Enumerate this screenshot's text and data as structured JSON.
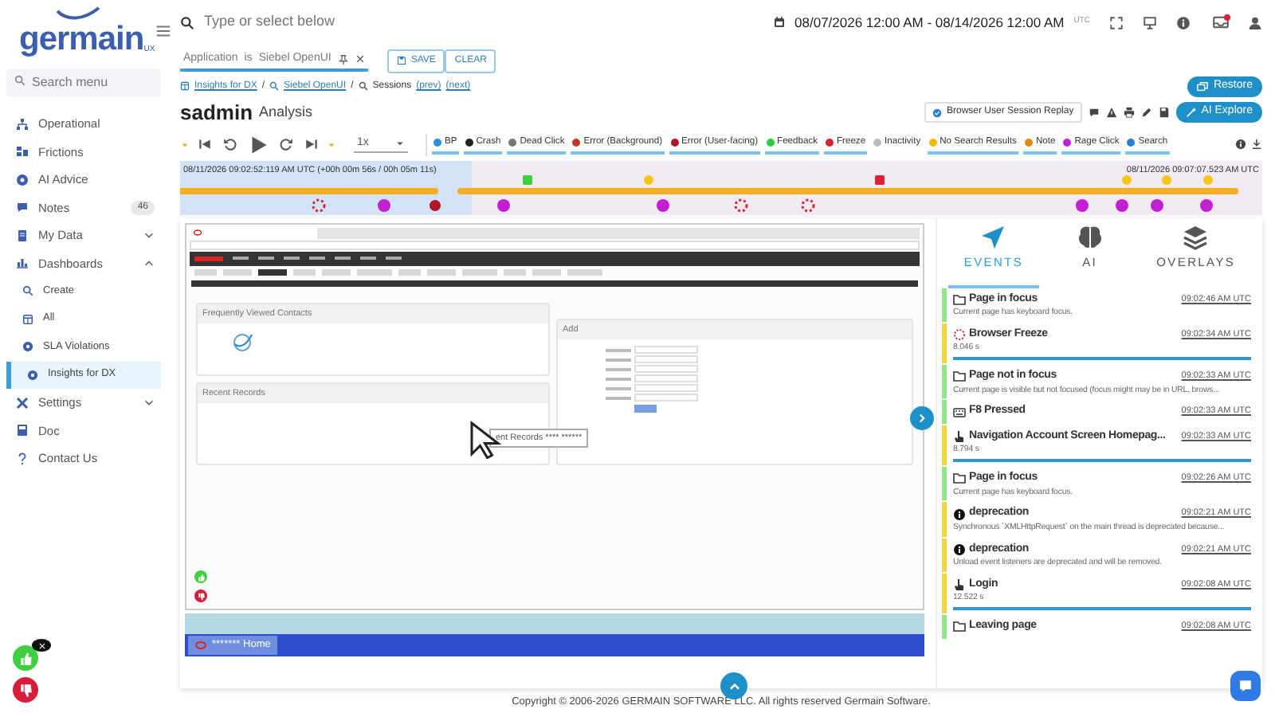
{
  "logo": {
    "name": "germain",
    "tag": "UX"
  },
  "sidebar": {
    "search": {
      "placeholder": "Search menu"
    },
    "items": [
      {
        "label": "Operational",
        "selected": false
      },
      {
        "label": "Frictions",
        "selected": false
      },
      {
        "label": "AI Advice",
        "selected": false
      },
      {
        "label": "Notes",
        "badge": "46",
        "selected": false
      },
      {
        "label": "My Data",
        "expanded": false,
        "selected": false
      },
      {
        "label": "Dashboards",
        "expanded": true,
        "selected": false,
        "children": [
          {
            "label": "Create",
            "selected": false
          },
          {
            "label": "All",
            "selected": false
          },
          {
            "label": "SLA Violations",
            "selected": false
          },
          {
            "label": "Insights for DX",
            "selected": true
          }
        ]
      },
      {
        "label": "Settings",
        "expanded": false,
        "selected": false
      },
      {
        "label": "Doc",
        "selected": false
      },
      {
        "label": "Contact Us",
        "selected": false
      }
    ]
  },
  "topbar": {
    "search": {
      "placeholder": "Type or select below"
    },
    "date_range": "08/07/2026 12:00 AM - 08/14/2026 12:00 AM",
    "timezone": "UTC",
    "notifications_unread": true
  },
  "filter": {
    "field": "Application",
    "operator": "is",
    "value": "Siebel OpenUI",
    "buttons": [
      "SAVE",
      "CLEAR"
    ]
  },
  "breadcrumb": [
    "Insights for DX",
    "Siebel OpenUI",
    "Sessions"
  ],
  "breadcrumb_separator": "/",
  "pager": [
    "(prev)",
    "(next)"
  ],
  "restore_button": "Restore",
  "title": "sadmin",
  "subtitle": "Analysis",
  "replay_label": "Browser User Session Replay",
  "ai_button": "AI Explore",
  "player": {
    "speed": "1x",
    "filters": [
      {
        "label": "BP",
        "color": "#2a8fd6",
        "selected": true
      },
      {
        "label": "Crash",
        "color": "#222222",
        "selected": true
      },
      {
        "label": "Dead Click",
        "color": "#777777",
        "selected": true
      },
      {
        "label": "Error (Background)",
        "color": "#c0392b",
        "selected": true
      },
      {
        "label": "Error (User-facing)",
        "color": "#b0182a",
        "selected": true
      },
      {
        "label": "Feedback",
        "color": "#2ecc40",
        "selected": true
      },
      {
        "label": "Freeze",
        "color": "#d9232d",
        "selected": true
      },
      {
        "label": "Inactivity",
        "color": "#bbbbbb",
        "selected": false
      },
      {
        "label": "No Search Results",
        "color": "#f2b705",
        "selected": true
      },
      {
        "label": "Note",
        "color": "#e08a00",
        "selected": true
      },
      {
        "label": "Rage Click",
        "color": "#c21fd3",
        "selected": true
      },
      {
        "label": "Search",
        "color": "#2a7fd6",
        "selected": true
      }
    ]
  },
  "timeline": {
    "start": "08/11/2026 09:02:52:119 AM UTC (+00h 00m 56s / 00h 05m 11s)",
    "end": "08/11/2026 09:07:07.523 AM UTC",
    "level": 0.27
  },
  "replay_frame": {
    "panels": [
      "Frequently Viewed Contacts",
      "Recent Records",
      "Add"
    ],
    "tooltip": "ent Records **** ******",
    "taskbar_item": "******* Home"
  },
  "panel": {
    "tabs": [
      {
        "label": "EVENTS",
        "selected": true
      },
      {
        "label": "AI",
        "selected": false
      },
      {
        "label": "OVERLAYS",
        "selected": false
      }
    ],
    "events": [
      {
        "kind": "focus",
        "title": "Page in focus",
        "time": "09:02:46 AM UTC",
        "detail": "Current page has keyboard focus.",
        "color": "#8ee58a",
        "divider_after": false
      },
      {
        "kind": "freeze",
        "title": "Browser Freeze",
        "time": "09:02:34 AM UTC",
        "detail": "8.046 s",
        "color": "#f4d447",
        "divider_after": true
      },
      {
        "kind": "focus",
        "title": "Page not in focus",
        "time": "09:02:33 AM UTC",
        "detail": "Current page is visible but not focused (focus might may be in URL, brows...",
        "color": "#8ee58a",
        "divider_after": false
      },
      {
        "kind": "key",
        "title": "F8 Pressed",
        "time": "09:02:33 AM UTC",
        "color": "#8ee58a",
        "divider_after": false
      },
      {
        "kind": "action",
        "title": "Navigation Account Screen Homepag...",
        "time": "09:02:33 AM UTC",
        "detail": "8.794 s",
        "color": "#f4d447",
        "divider_after": true
      },
      {
        "kind": "focus",
        "title": "Page in focus",
        "time": "09:02:26 AM UTC",
        "detail": "Current page has keyboard focus.",
        "color": "#8ee58a",
        "divider_after": false
      },
      {
        "kind": "console",
        "title": "deprecation",
        "time": "09:02:21 AM UTC",
        "detail": "Synchronous `XMLHttpRequest` on the main thread is deprecated because...",
        "color": "#f4d447",
        "divider_after": false
      },
      {
        "kind": "console",
        "title": "deprecation",
        "time": "09:02:21 AM UTC",
        "detail": "Unload event listeners are deprecated and will be removed.",
        "color": "#f4d447",
        "divider_after": false
      },
      {
        "kind": "action",
        "title": "Login",
        "time": "09:02:08 AM UTC",
        "detail": "12.522 s",
        "color": "#f4d447",
        "divider_after": true
      },
      {
        "kind": "focus",
        "title": "Leaving page",
        "time": "09:02:08 AM UTC",
        "color": "#8ee58a",
        "divider_after": false
      }
    ]
  },
  "footer": "Copyright © 2006-2026 GERMAIN SOFTWARE LLC. All rights reserved Germain Software."
}
